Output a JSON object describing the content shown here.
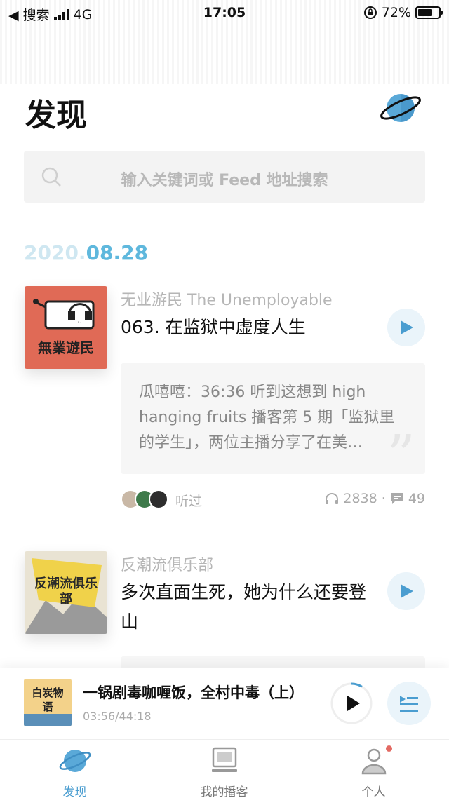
{
  "status_bar": {
    "back_label": "◀ 搜索",
    "network": "4G",
    "time": "17:05",
    "battery": "72%",
    "battery_level": 0.72
  },
  "header": {
    "title": "发现"
  },
  "search": {
    "placeholder": "输入关键词或 Feed 地址搜索"
  },
  "date": {
    "year": "2020.",
    "month_day": "08.28"
  },
  "episodes": [
    {
      "podcast": "无业游民 The Unemployable",
      "title": "063. 在监狱中虚度人生",
      "cover_text": "無業遊民",
      "comment": "瓜嘻嘻：36:36 听到这想到 high hanging fruits 播客第 5 期「监狱里的学生」，两位主播分享了在美…",
      "listened_label": "听过",
      "plays": "2838",
      "comments": "49"
    },
    {
      "podcast": "反潮流俱乐部",
      "title": "多次直面生死，她为什么还要登山",
      "cover_text": "反潮流俱乐部"
    }
  ],
  "player": {
    "title": "一锅剧毒咖喱饭，全村中毒（上）",
    "time": "03:56/44:18",
    "cover_text": "白炭物语",
    "progress": 0.089
  },
  "tabs": [
    {
      "label": "发现",
      "active": true
    },
    {
      "label": "我的播客",
      "active": false
    },
    {
      "label": "个人",
      "active": false
    }
  ],
  "colors": {
    "accent": "#4a9dd0",
    "cover_red": "#e06a56",
    "badge": "#e36a63"
  }
}
